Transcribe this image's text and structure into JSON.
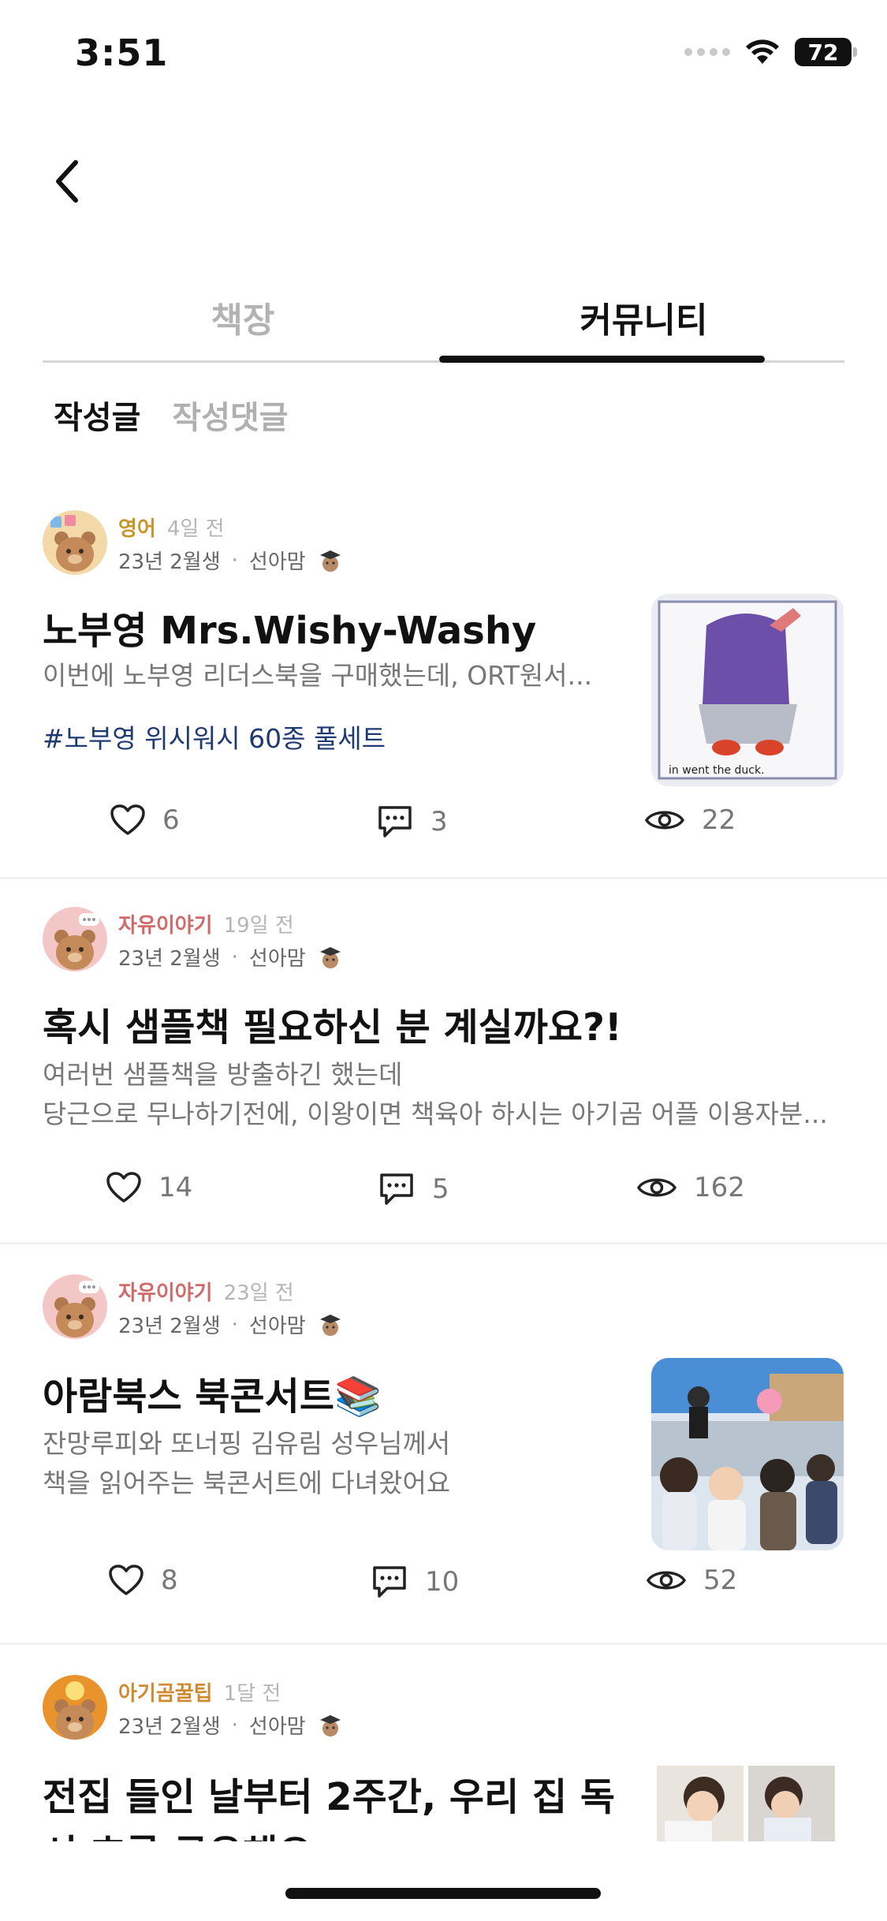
{
  "status": {
    "time": "3:51",
    "battery": "72"
  },
  "tabs": {
    "bookshelf": "책장",
    "community": "커뮤니티"
  },
  "subtabs": {
    "posts": "작성글",
    "comments": "작성댓글"
  },
  "colors": {
    "cat_english": "#c8972b",
    "cat_free": "#d06a6a",
    "cat_tip": "#d08a30",
    "tag": "#1f3a73"
  },
  "posts": [
    {
      "category": "영어",
      "time": "4일 전",
      "birth": "23년 2월생",
      "author": "선아맘",
      "title": "노부영 Mrs.Wishy-Washy",
      "body1": "이번에 노부영 리더스북을 구매했는데, ORT원서...",
      "tag": "#노부영 위시워시 60종 풀세트",
      "likes": "6",
      "comments": "3",
      "views": "22",
      "thumb_caption": "in went the duck."
    },
    {
      "category": "자유이야기",
      "time": "19일 전",
      "birth": "23년 2월생",
      "author": "선아맘",
      "title": "혹시 샘플책 필요하신 분 계실까요?!",
      "body1": "여러번 샘플책을 방출하긴 했는데",
      "body2": "당근으로 무나하기전에, 이왕이면 책육아 하시는 아기곰 어플 이용자분...",
      "likes": "14",
      "comments": "5",
      "views": "162"
    },
    {
      "category": "자유이야기",
      "time": "23일 전",
      "birth": "23년 2월생",
      "author": "선아맘",
      "title": "아람북스 북콘서트📚",
      "body1": "잔망루피와 또너핑 김유림 성우님께서",
      "body2": "책을 읽어주는 북콘서트에 다녀왔어요",
      "likes": "8",
      "comments": "10",
      "views": "52"
    },
    {
      "category": "아기곰꿀팁",
      "time": "1달 전",
      "birth": "23년 2월생",
      "author": "선아맘",
      "title": "전집 들인 날부터 2주간, 우리 집 독",
      "title2": "서 흐름 공유해요"
    }
  ]
}
